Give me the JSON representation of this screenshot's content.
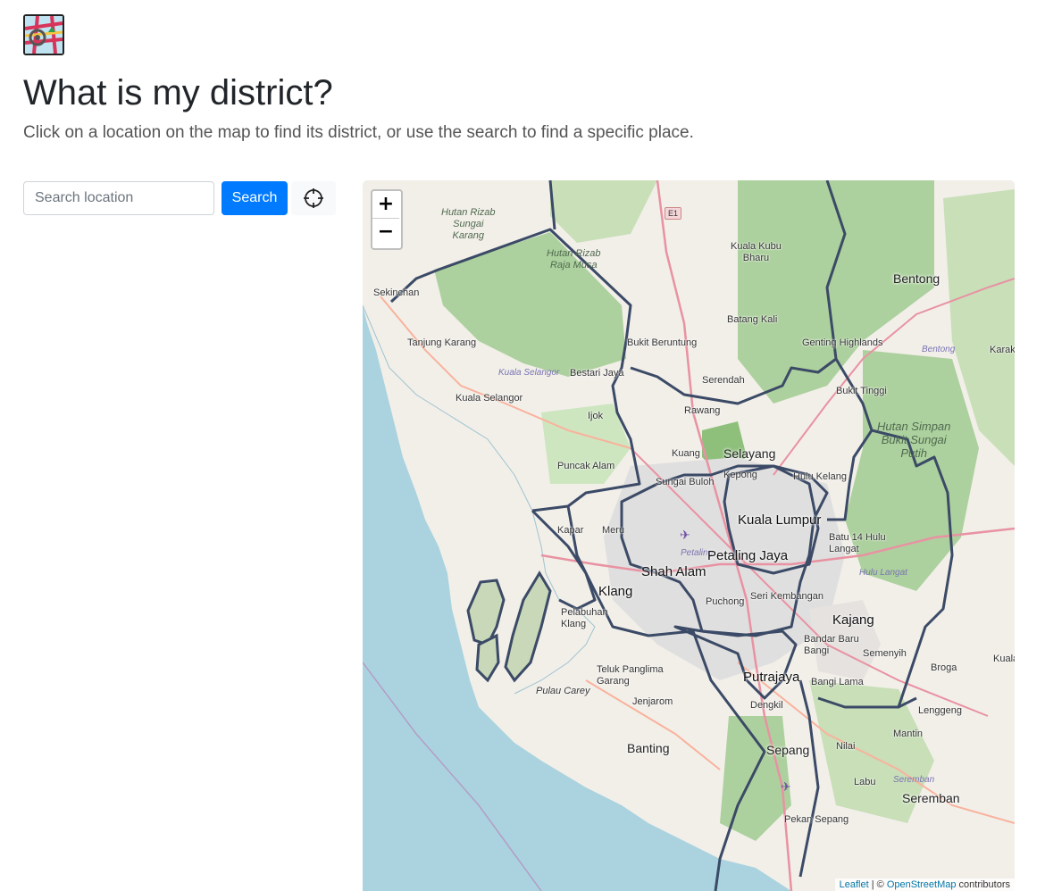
{
  "page": {
    "title": "What is my district?",
    "lead": "Click on a location on the map to find its district, or use the search to find a specific place."
  },
  "search": {
    "placeholder": "Search location",
    "button_label": "Search"
  },
  "map": {
    "zoom_in": "+",
    "zoom_out": "−",
    "attribution": {
      "leaflet": "Leaflet",
      "separator": " | © ",
      "osm": "OpenStreetMap",
      "suffix": " contributors"
    },
    "labels": {
      "bentong": "Bentong",
      "bentong_italic": "Bentong",
      "karak": "Karak",
      "kuala_kubu_bharu": "Kuala Kubu\nBharu",
      "batang_kali": "Batang Kali",
      "bukit_beruntung": "Bukit Beruntung",
      "genting_highlands": "Genting Highlands",
      "serendah": "Serendah",
      "rawang": "Rawang",
      "bukit_tinggi": "Bukit Tinggi",
      "hutan_simpan_bukit_sungai_putih": "Hutan Simpan\nBukit Sungai\nPutih",
      "selayang": "Selayang",
      "kuang": "Kuang",
      "kepong": "Kepong",
      "hulu_kelang": "Hulu Kelang",
      "kuala_lumpur": "Kuala Lumpur",
      "batu_14_hulu_langat": "Batu 14 Hulu\nLangat",
      "hulu_langat": "Hulu Langat",
      "petaling_jaya": "Petaling Jaya",
      "petaling": "Petaling",
      "shah_alam": "Shah Alam",
      "klang": "Klang",
      "seri_kembangan": "Seri Kembangan",
      "puchong": "Puchong",
      "kajang": "Kajang",
      "bandar_baru_bangi": "Bandar Baru\nBangi",
      "semenyih": "Semenyih",
      "broga": "Broga",
      "kuala": "Kuala",
      "bangi_lama": "Bangi Lama",
      "putrajaya": "Putrajaya",
      "dengkil": "Dengkil",
      "lenggeng": "Lenggeng",
      "mantin": "Mantin",
      "nilai": "Nilai",
      "sepang": "Sepang",
      "labu": "Labu",
      "seremban": "Seremban",
      "seremban_italic": "Seremban",
      "pekan_sepang": "Pekan Sepang",
      "banting": "Banting",
      "jenjarom": "Jenjarom",
      "teluk_panglima_garang": "Teluk Panglima\nGarang",
      "pulau_carey": "Pulau Carey",
      "pelabuhan_klang": "Pelabuhan\nKlang",
      "kapar": "Kapar",
      "meru": "Meru",
      "puncak_alam": "Puncak Alam",
      "sungai_buloh": "Sungai Buloh",
      "ijok": "Ijok",
      "bestari_jaya": "Bestari Jaya",
      "kuala_selangor_italic": "Kuala Selangor",
      "kuala_selangor": "Kuala Selangor",
      "tanjung_karang": "Tanjung Karang",
      "sekinchan": "Sekinchan",
      "hutan_rizab_sungai_karang": "Hutan Rizab\nSungai\nKarang",
      "hutan_rizab_raja_musa": "Hutan Rizab\nRaja Musa",
      "e1": "E1"
    }
  },
  "colors": {
    "primary": "#007bff",
    "sea": "#aad3df",
    "land": "#f2efe9",
    "forest": "#add19e",
    "district_border": "#3b4a66",
    "motorway": "#e892a2",
    "urban": "#e0dfdf"
  },
  "icons": {
    "logo": "map-logo-icon",
    "locate": "crosshair-icon"
  }
}
